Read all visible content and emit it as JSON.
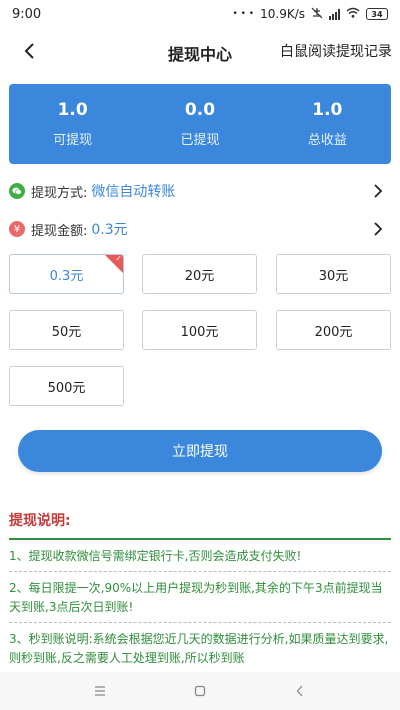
{
  "statusbar": {
    "time": "9:00",
    "dots": "• • •",
    "network_speed": "10.9K/s",
    "battery": "34"
  },
  "header": {
    "back_icon": "chevron-left-icon",
    "title": "提现中心",
    "right_link": "白鼠阅读提现记录"
  },
  "summary": [
    {
      "value": "1.0",
      "label": "可提现"
    },
    {
      "value": "0.0",
      "label": "已提现"
    },
    {
      "value": "1.0",
      "label": "总收益"
    }
  ],
  "method": {
    "icon": "wechat-icon",
    "label": "提现方式:",
    "value": "微信自动转账"
  },
  "amount": {
    "icon": "yen-icon",
    "label": "提现金额:",
    "value": "0.3元"
  },
  "amount_options": [
    {
      "label": "0.3元",
      "selected": true
    },
    {
      "label": "20元",
      "selected": false
    },
    {
      "label": "30元",
      "selected": false
    },
    {
      "label": "50元",
      "selected": false
    },
    {
      "label": "100元",
      "selected": false
    },
    {
      "label": "200元",
      "selected": false
    },
    {
      "label": "500元",
      "selected": false
    }
  ],
  "submit_label": "立即提现",
  "notes": {
    "title": "提现说明:",
    "items": [
      "1、提现收款微信号需绑定银行卡,否则会造成支付失败!",
      "2、每日限提一次,90%以上用户提现为秒到账,其余的下午3点前提现当天到账,3点后次日到账!",
      "3、秒到账说明:系统会根据您近几天的数据进行分析,如果质量达到要求,则秒到账,反之需要人工处理到账,所以秒到账"
    ]
  },
  "colors": {
    "primary": "#3a87db",
    "notes_text": "#2f8f3a",
    "notes_title": "#c63a3a",
    "selected_corner": "#e85a5a"
  }
}
